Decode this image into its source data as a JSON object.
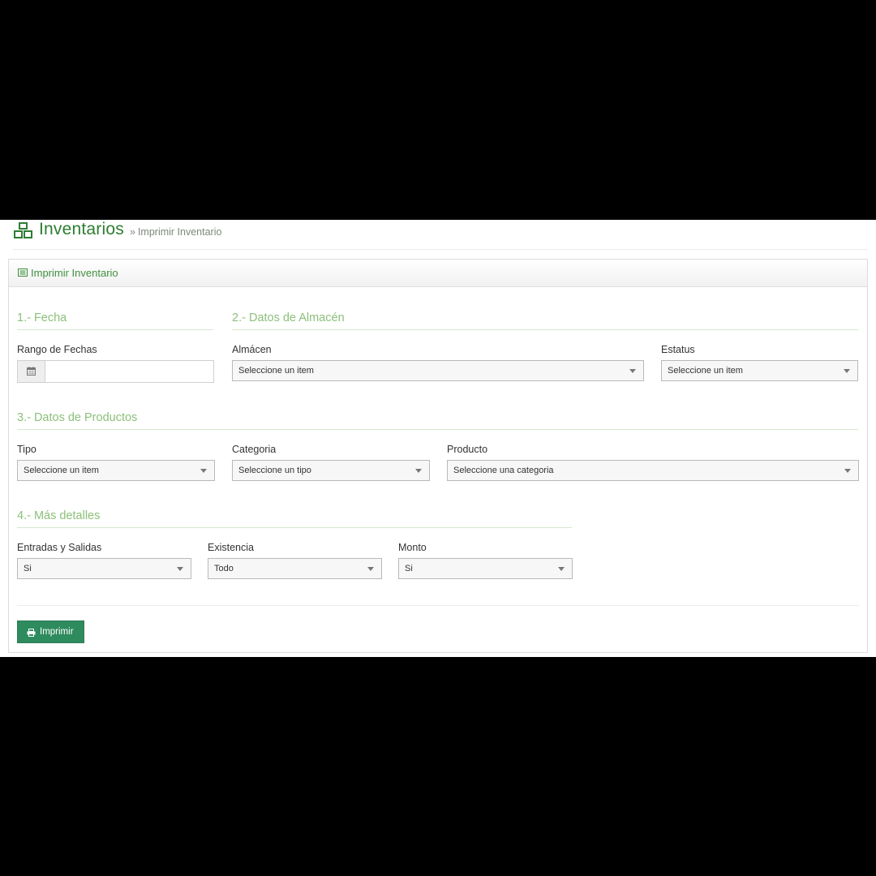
{
  "header": {
    "title": "Inventarios",
    "breadcrumb_sep": "»",
    "breadcrumb_current": "Imprimir Inventario"
  },
  "panel": {
    "title": "Imprimir Inventario"
  },
  "sections": {
    "fecha": "1.- Fecha",
    "almacen": "2.- Datos de Almacén",
    "productos": "3.- Datos de Productos",
    "detalles": "4.- Más detalles"
  },
  "fields": {
    "rango_fechas": {
      "label": "Rango de Fechas",
      "value": ""
    },
    "almacen": {
      "label": "Almácen",
      "value": "Seleccione un item"
    },
    "estatus": {
      "label": "Estatus",
      "value": "Seleccione un item"
    },
    "tipo": {
      "label": "Tipo",
      "value": "Seleccione un item"
    },
    "categoria": {
      "label": "Categoria",
      "value": "Seleccione un tipo"
    },
    "producto": {
      "label": "Producto",
      "value": "Seleccione una categoria"
    },
    "entradas_salidas": {
      "label": "Entradas y Salidas",
      "value": "Si"
    },
    "existencia": {
      "label": "Existencia",
      "value": "Todo"
    },
    "monto": {
      "label": "Monto",
      "value": "Si"
    }
  },
  "actions": {
    "print_label": "Imprimir"
  },
  "colors": {
    "brand": "#2e7d32",
    "section": "#8cc07a",
    "button": "#2e8b5e"
  },
  "icons": {
    "logo": "boxes-icon",
    "panel": "list-icon",
    "date": "calendar-icon",
    "print": "printer-icon",
    "select": "caret-down-icon"
  }
}
